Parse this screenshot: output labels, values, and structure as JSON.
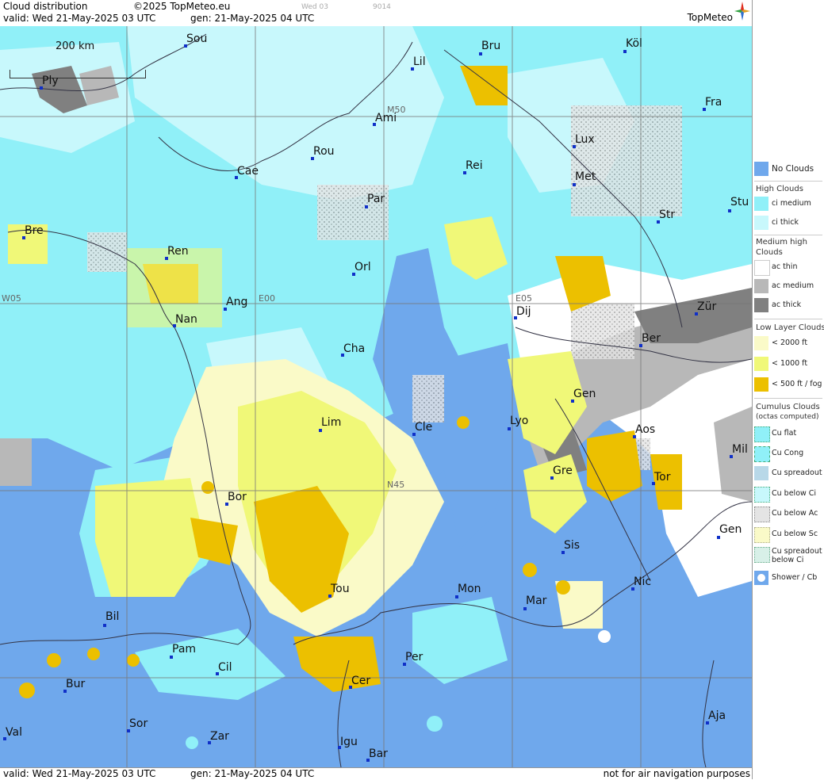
{
  "header": {
    "title": "Cloud distribution",
    "copyright": "©2025 TopMeteo.eu",
    "valid": "valid:  Wed  21-May-2025  03 UTC",
    "gen": "gen: 21-May-2025 04 UTC",
    "small1": "Wed 03",
    "small2": "9014",
    "brand": "TopMeteo"
  },
  "scale": {
    "label": "200 km"
  },
  "footer": {
    "valid": "valid:  Wed  21-May-2025  03 UTC",
    "gen": "gen: 21-May-2025 04 UTC",
    "note": "not for air navigation purposes"
  },
  "grid_labels": [
    "W05",
    "E00",
    "E05",
    "N45",
    "M50"
  ],
  "cities": [
    "Sou",
    "Bru",
    "Köl",
    "Ply",
    "Lil",
    "Fra",
    "Ami",
    "Lux",
    "Rou",
    "Cae",
    "Rei",
    "Met",
    "Par",
    "Stu",
    "Bre",
    "Str",
    "Ren",
    "Orl",
    "Ang",
    "Dij",
    "Zür",
    "Nan",
    "Ber",
    "Cha",
    "Gen",
    "Lim",
    "Lyo",
    "Cle",
    "Aos",
    "Mil",
    "Gre",
    "Bor",
    "Tor",
    "Gen",
    "Sis",
    "Tou",
    "Mon",
    "Mar",
    "Nic",
    "Bil",
    "Pam",
    "Cil",
    "Per",
    "Cer",
    "Bur",
    "Sor",
    "Aja",
    "Val",
    "Zar",
    "Igu",
    "Bar"
  ],
  "legend": {
    "no_clouds": "No Clouds",
    "high_head": "High Clouds",
    "ci_medium": "ci medium",
    "ci_thick": "ci thick",
    "medium_head1": "Medium high",
    "medium_head2": "Clouds",
    "ac_thin": "ac thin",
    "ac_medium": "ac medium",
    "ac_thick": "ac thick",
    "low_head": "Low Layer Clouds",
    "low1": "< 2000 ft",
    "low2": "< 1000 ft",
    "low3": "< 500 ft / fog",
    "cu_head1": "Cumulus Clouds",
    "cu_head2": "(octas computed)",
    "cu_flat": "Cu flat",
    "cu_cong": "Cu Cong",
    "cu_spread": "Cu spreadout",
    "cu_below_ci": "Cu below Ci",
    "cu_below_ac": "Cu below Ac",
    "cu_below_sc": "Cu below Sc",
    "cu_spread_ci1": "Cu spreadout",
    "cu_spread_ci2": "below Ci",
    "shower": "Shower / Cb"
  },
  "colors": {
    "no_clouds": "#6fa8ec",
    "ci_medium": "#90f0f8",
    "ci_thick": "#c8f8fc",
    "ac_thin": "#ffffff",
    "ac_medium": "#b8b8b8",
    "ac_thick": "#808080",
    "low_2000": "#fafac8",
    "low_1000": "#f0f878",
    "low_500": "#ecc000"
  }
}
